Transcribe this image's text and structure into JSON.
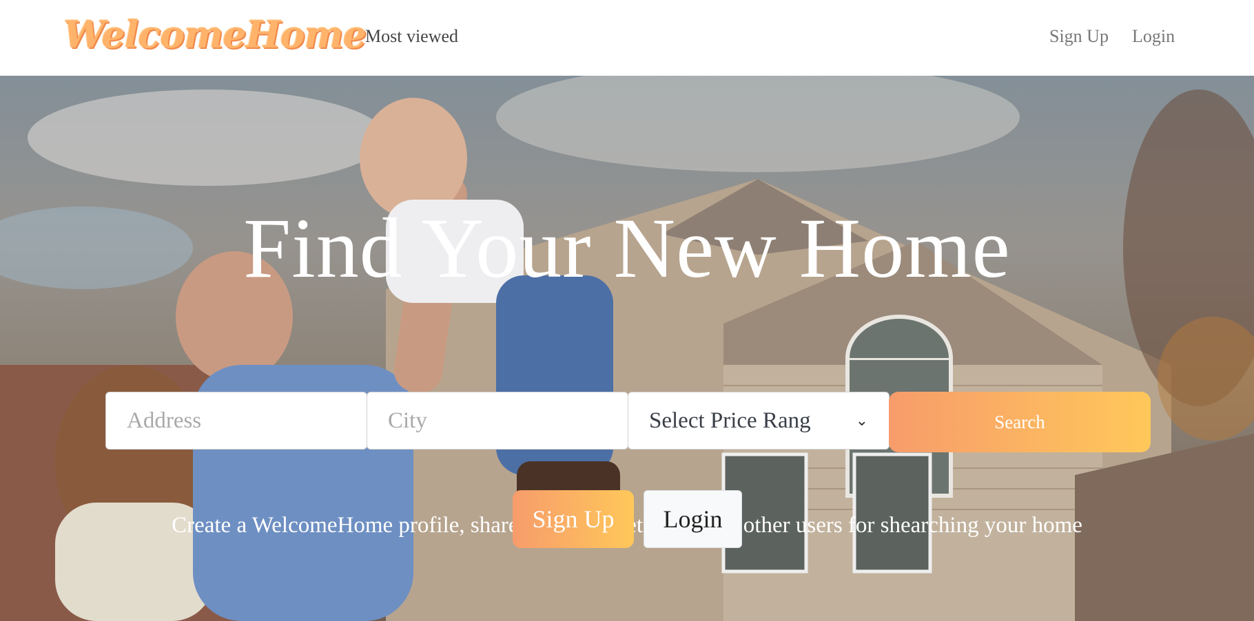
{
  "nav": {
    "logo": "WelcomeHome",
    "most_viewed": "Most viewed",
    "sign_up": "Sign Up",
    "login": "Login"
  },
  "hero": {
    "title": "Find Your New Home",
    "tagline": "Create a WelcomeHome profile, share posts and get help from other users for shearching your home",
    "background_image": "family lifting child in front of a house"
  },
  "search": {
    "address_placeholder": "Address",
    "city_placeholder": "City",
    "price_select_value": "Select Price Rang",
    "button_label": "Search"
  },
  "cta": {
    "sign_up": "Sign Up",
    "login": "Login"
  },
  "colors": {
    "accent_start": "#f79c6b",
    "accent_end": "#ffc85a",
    "logo": "#ffb36b"
  }
}
